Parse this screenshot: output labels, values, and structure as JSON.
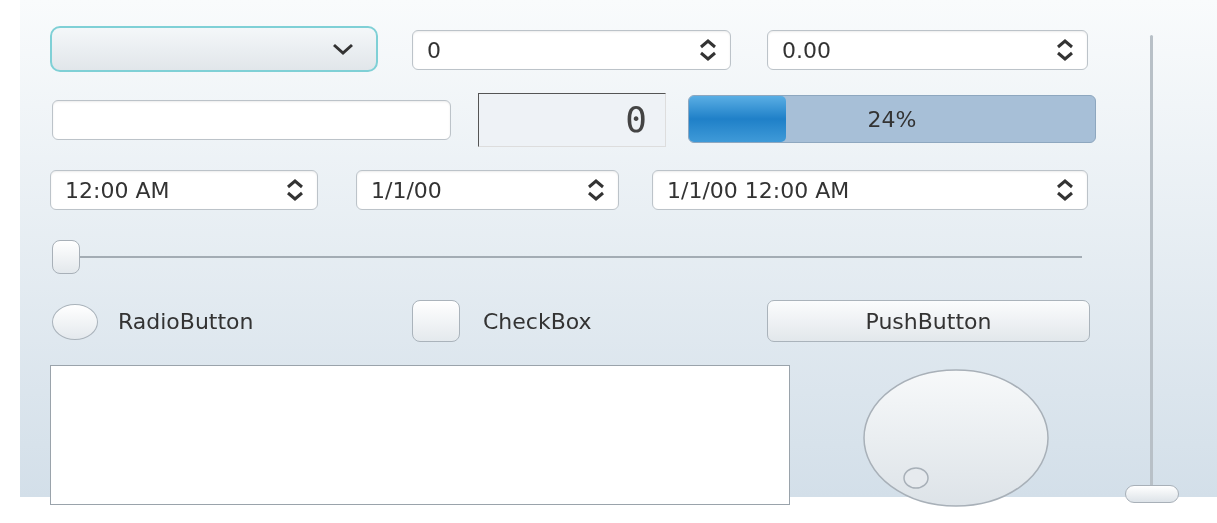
{
  "combo_box": {
    "focused": true
  },
  "spin_box": {
    "value": "0"
  },
  "double_spin_box": {
    "value": "0.00"
  },
  "lcd_number": {
    "value": "0"
  },
  "progress_bar": {
    "level": 0.24,
    "text": "24%"
  },
  "time_edit": {
    "value": "12:00 AM"
  },
  "date_edit": {
    "value": "1/1/00"
  },
  "date_time_edit": {
    "value": "1/1/00 12:00 AM"
  },
  "horizontal_slider": {
    "level": 0
  },
  "radio_button": {
    "label": "RadioButton",
    "selected": false
  },
  "check_box": {
    "label": "CheckBox",
    "checked": false
  },
  "push_button": {
    "label": "PushButton"
  },
  "vertical_slider": {
    "level": 0
  }
}
